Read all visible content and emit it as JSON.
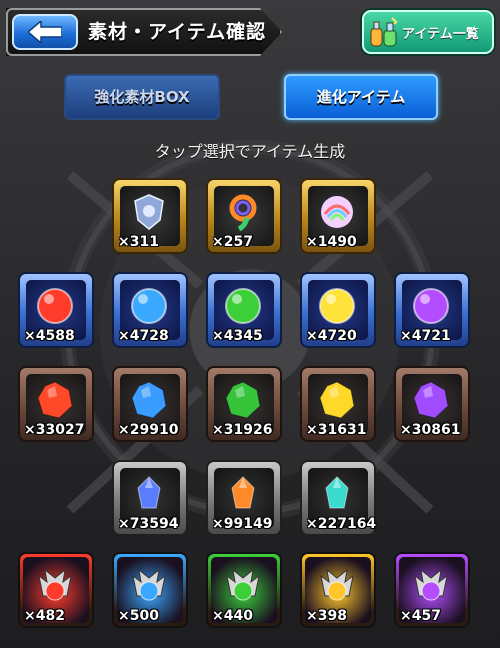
{
  "header": {
    "title": "素材・アイテム確認",
    "list_button_label": "アイテム一覧",
    "list_button_icon": "potion-bottles-icon",
    "back_icon": "back-arrow-icon"
  },
  "tabs": [
    {
      "label": "強化素材BOX",
      "active": false
    },
    {
      "label": "進化アイテム",
      "active": true
    }
  ],
  "subtitle": "タップ選択でアイテム生成",
  "rows": [
    {
      "frame": "gold",
      "items": [
        {
          "name": "crest",
          "qty": "×311",
          "color": "#b9d4ff"
        },
        {
          "name": "rainbow-swirl",
          "qty": "×257",
          "color": "#ff9a4a"
        },
        {
          "name": "rainbow-gem",
          "qty": "×1490",
          "color": "#f4c6ff"
        }
      ]
    },
    {
      "frame": "blue",
      "items": [
        {
          "name": "fire-orb",
          "qty": "×4588",
          "color": "#ff3b2b"
        },
        {
          "name": "water-orb",
          "qty": "×4728",
          "color": "#3aa8ff"
        },
        {
          "name": "wood-orb",
          "qty": "×4345",
          "color": "#3ccf3a"
        },
        {
          "name": "light-orb",
          "qty": "×4720",
          "color": "#ffe23a"
        },
        {
          "name": "dark-orb",
          "qty": "×4721",
          "color": "#b34dff"
        }
      ]
    },
    {
      "frame": "bronze",
      "items": [
        {
          "name": "fire-stone",
          "qty": "×33027",
          "color": "#ff4a2a"
        },
        {
          "name": "water-stone",
          "qty": "×29910",
          "color": "#3a9cff"
        },
        {
          "name": "wood-stone",
          "qty": "×31926",
          "color": "#35c43a"
        },
        {
          "name": "light-stone",
          "qty": "×31631",
          "color": "#ffd92a"
        },
        {
          "name": "dark-stone",
          "qty": "×30861",
          "color": "#a14dff"
        }
      ]
    },
    {
      "frame": "grey",
      "items": [
        {
          "name": "large-crystal",
          "qty": "×73594",
          "color": "#5a7dff"
        },
        {
          "name": "medium-crystal",
          "qty": "×99149",
          "color": "#ff8a2a"
        },
        {
          "name": "small-crystal",
          "qty": "×227164",
          "color": "#3adcd0"
        }
      ]
    },
    {
      "frame": "elem",
      "items": [
        {
          "name": "fire-dragon",
          "qty": "×482",
          "color": "#ff3b2b"
        },
        {
          "name": "water-dragon",
          "qty": "×500",
          "color": "#3aa8ff"
        },
        {
          "name": "wood-dragon",
          "qty": "×440",
          "color": "#3ccf3a"
        },
        {
          "name": "light-dragon",
          "qty": "×398",
          "color": "#ffc52a"
        },
        {
          "name": "dark-dragon",
          "qty": "×457",
          "color": "#b34dff"
        }
      ]
    }
  ]
}
